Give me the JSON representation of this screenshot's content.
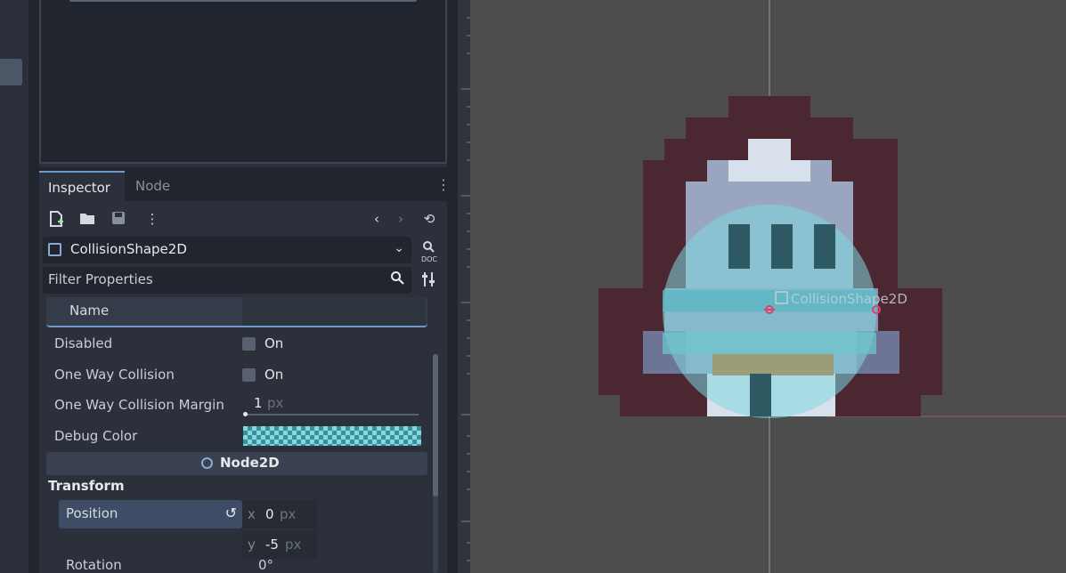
{
  "inspector": {
    "tabs": [
      "Inspector",
      "Node"
    ],
    "toolbar_icons": [
      "new-resource-icon",
      "open-folder-icon",
      "save-icon",
      "more-icon",
      "back-icon",
      "forward-icon",
      "history-icon"
    ],
    "object_name": "CollisionShape2D",
    "filter_placeholder": "Filter Properties",
    "properties": {
      "name_label": "Name",
      "disabled": {
        "label": "Disabled",
        "value": "On",
        "checked": false
      },
      "one_way": {
        "label": "One Way Collision",
        "value": "On",
        "checked": false
      },
      "margin": {
        "label": "One Way Collision Margin",
        "value": "1",
        "unit": "px"
      },
      "debug_color": {
        "label": "Debug Color",
        "color": "#7fd9e0"
      }
    },
    "section": "Node2D",
    "group": "Transform",
    "position": {
      "label": "Position",
      "x_axis": "x",
      "x": "0",
      "y_axis": "y",
      "y": "-5",
      "unit": "px"
    },
    "rotation": {
      "label": "Rotation",
      "value": "0",
      "unit": "°"
    }
  },
  "viewport": {
    "shape_label": "CollisionShape2D",
    "background": "#4d4d4d",
    "collision_color": "#7fd9e0"
  }
}
